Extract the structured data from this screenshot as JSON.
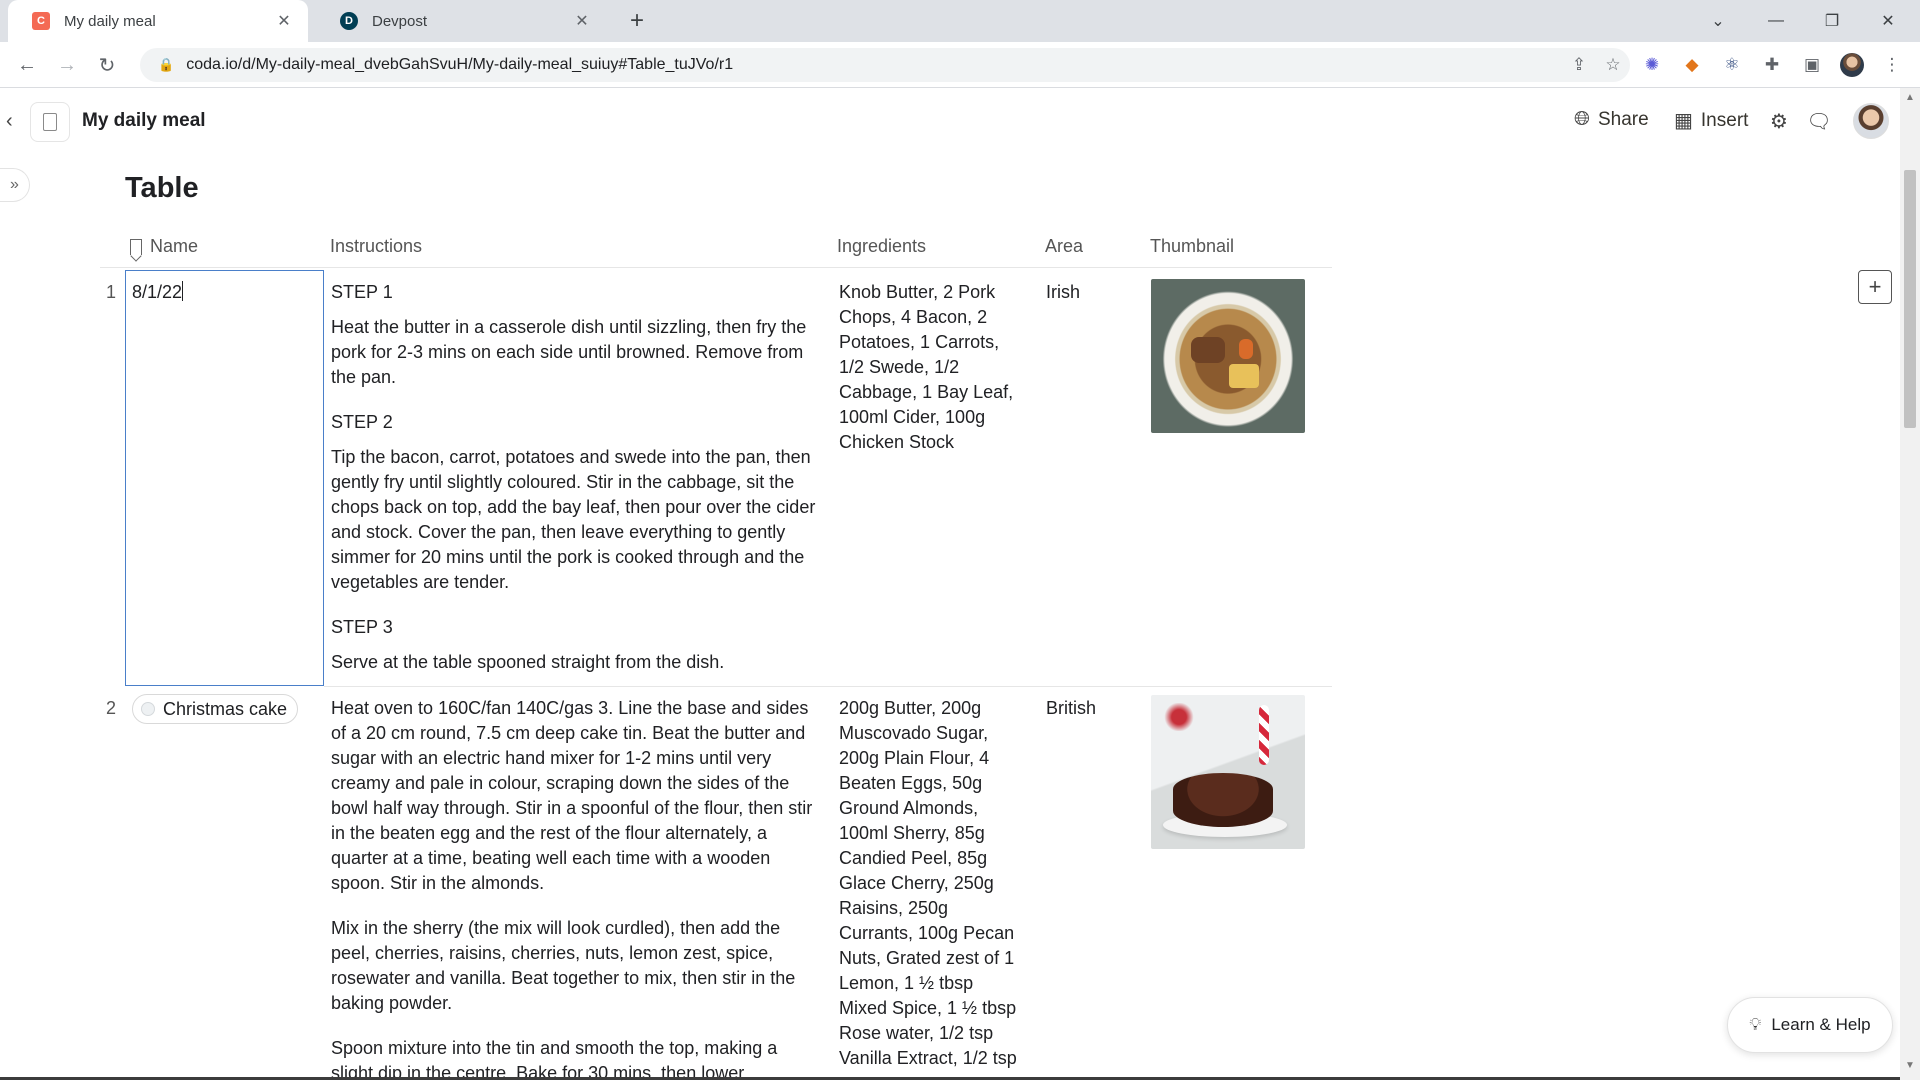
{
  "browser": {
    "tabs": [
      {
        "title": "My daily meal",
        "active": true
      },
      {
        "title": "Devpost",
        "active": false
      }
    ],
    "url": "coda.io/d/My-daily-meal_dvebGahSvuH/My-daily-meal_suiuy#Table_tuJVo/r1"
  },
  "doc": {
    "title": "My daily meal",
    "share_label": "Share",
    "insert_label": "Insert"
  },
  "page": {
    "heading": "Table"
  },
  "table": {
    "columns": [
      "Name",
      "Instructions",
      "Ingredients",
      "Area",
      "Thumbnail"
    ],
    "rows": [
      {
        "num": "1",
        "name": "8/1/22",
        "steps": [
          {
            "label": "STEP 1",
            "text": "Heat the butter in a casserole dish until sizzling, then fry the pork for 2-3 mins on each side until browned. Remove from the pan."
          },
          {
            "label": "STEP 2",
            "text": "Tip the bacon, carrot, potatoes and swede into the pan, then gently fry until slightly coloured. Stir in the cabbage, sit the chops back on top, add the bay leaf, then pour over the cider and stock. Cover the pan, then leave everything to gently simmer for 20 mins until the pork is cooked through and the vegetables are tender."
          },
          {
            "label": "STEP 3",
            "text": "Serve at the table spooned straight from the dish."
          }
        ],
        "ingredients": "Knob Butter, 2 Pork Chops, 4 Bacon, 2 Potatoes, 1 Carrots, 1/2  Swede, 1/2 Cabbage, 1 Bay Leaf, 100ml Cider, 100g Chicken Stock",
        "area": "Irish",
        "thumbnail_alt": "stew-photo"
      },
      {
        "num": "2",
        "name": "Christmas cake",
        "paragraphs": [
          "Heat oven to 160C/fan 140C/gas 3. Line the base and sides of a 20 cm round, 7.5 cm deep cake tin. Beat the butter and sugar with an electric hand mixer for 1-2 mins until very creamy and pale in colour, scraping down the sides of the bowl half way through. Stir in a spoonful of the flour, then stir in the beaten egg and the rest of the flour alternately, a quarter at a time, beating well each time with a wooden spoon. Stir in the almonds.",
          "Mix in the sherry (the mix will look curdled), then add the peel, cherries, raisins, cherries, nuts, lemon zest, spice, rosewater and vanilla. Beat together to mix, then stir in the baking powder.",
          "Spoon mixture into the tin and smooth the top, making a slight dip in the centre. Bake for 30 mins, then lower"
        ],
        "ingredients": "200g Butter, 200g Muscovado Sugar, 200g Plain Flour, 4 Beaten Eggs, 50g Ground Almonds, 100ml Sherry, 85g Candied Peel, 85g Glace Cherry, 250g Raisins, 250g Currants, 100g  Pecan Nuts, Grated zest of 1 Lemon, 1 ½ tbsp Mixed Spice, 1 ½ tbsp Rose water, 1/2 tsp Vanilla Extract, 1/2 tsp",
        "area": "British",
        "thumbnail_alt": "christmas-cake-photo"
      }
    ]
  },
  "help": {
    "label": "Learn & Help"
  },
  "colors": {
    "accent_border": "#4a7fc9",
    "coda_brand": "#f46a54"
  }
}
